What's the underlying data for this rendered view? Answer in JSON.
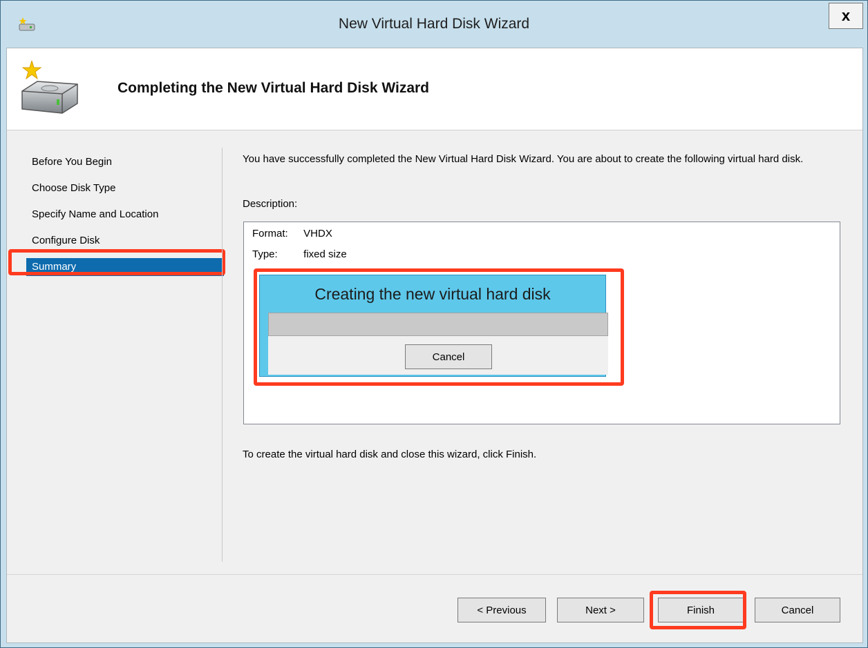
{
  "window": {
    "title": "New Virtual Hard Disk Wizard",
    "close_label": "x"
  },
  "header": {
    "title": "Completing the New Virtual Hard Disk Wizard"
  },
  "steps": [
    {
      "label": "Before You Begin"
    },
    {
      "label": "Choose Disk Type"
    },
    {
      "label": "Specify Name and Location"
    },
    {
      "label": "Configure Disk"
    },
    {
      "label": "Summary"
    }
  ],
  "main": {
    "intro": "You have successfully completed the New Virtual Hard Disk Wizard. You are about to create the following virtual hard disk.",
    "description_label": "Description:",
    "details": [
      {
        "key": "Format:",
        "value": "VHDX"
      },
      {
        "key": "Type:",
        "value": "fixed size"
      }
    ],
    "finish_note": "To create the virtual hard disk and close this wizard, click Finish."
  },
  "progress_dialog": {
    "title": "Creating the new virtual hard disk",
    "cancel_label": "Cancel",
    "progress": 0
  },
  "footer": {
    "previous_label": "< Previous",
    "next_label": "Next >",
    "finish_label": "Finish",
    "cancel_label": "Cancel"
  },
  "colors": {
    "highlight": "#ff3b1f",
    "selection": "#0d6bae",
    "progress_panel": "#5ec8ea"
  }
}
